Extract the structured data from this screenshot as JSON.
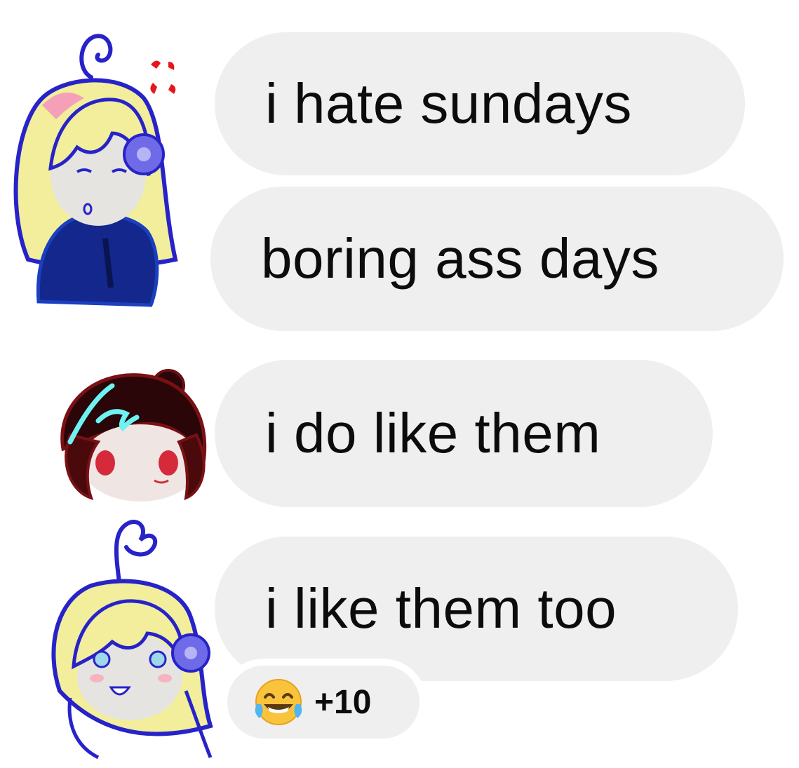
{
  "messages": [
    {
      "text": "i hate sundays"
    },
    {
      "text": "boring ass days"
    },
    {
      "text": "i do like them"
    },
    {
      "text": "i like them too"
    }
  ],
  "reaction": {
    "emoji": "face-with-tears-of-joy-icon",
    "count": "+10"
  },
  "avatars": [
    {
      "name": "blonde-character-angry"
    },
    {
      "name": "dark-hair-character"
    },
    {
      "name": "blonde-character-happy"
    }
  ],
  "colors": {
    "bubble": "#efeff0",
    "text": "#0c0c0c",
    "outline_blue": "#2723c9",
    "hair_blonde": "#f2ee9c",
    "hair_dark": "#2a0608",
    "anger_red": "#e8151b",
    "accent_cyan": "#6ef2f2",
    "uniform_blue": "#13278c"
  }
}
